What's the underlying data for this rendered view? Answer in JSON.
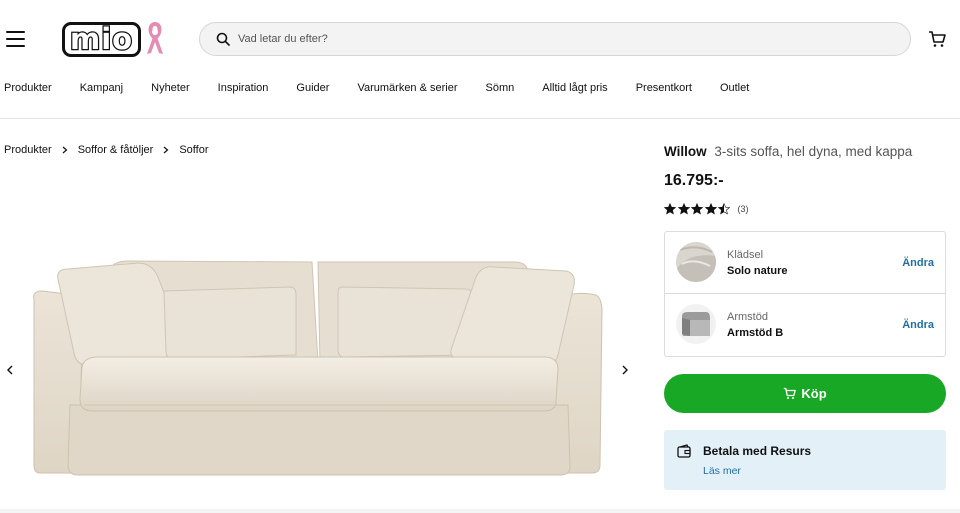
{
  "header": {
    "logo_text": "mio",
    "search_placeholder": "Vad letar du efter?"
  },
  "nav": [
    "Produkter",
    "Kampanj",
    "Nyheter",
    "Inspiration",
    "Guider",
    "Varumärken & serier",
    "Sömn",
    "Alltid lågt pris",
    "Presentkort",
    "Outlet"
  ],
  "breadcrumb": [
    "Produkter",
    "Soffor & fåtöljer",
    "Soffor"
  ],
  "product": {
    "name": "Willow",
    "subtitle": "3-sits soffa, hel dyna, med kappa",
    "price": "16.795:-",
    "rating_value": 4.5,
    "rating_count": "(3)",
    "options": [
      {
        "label": "Klädsel",
        "value": "Solo nature",
        "action": "Ändra"
      },
      {
        "label": "Armstöd",
        "value": "Armstöd B",
        "action": "Ändra"
      }
    ],
    "buy_label": "Köp",
    "payment": {
      "title": "Betala med Resurs",
      "link": "Läs mer"
    }
  },
  "colors": {
    "buy_green": "#19a826",
    "link_blue": "#1f6fa6",
    "payment_bg": "#e4f0f8",
    "sofa_fabric": "#ece5d8"
  }
}
